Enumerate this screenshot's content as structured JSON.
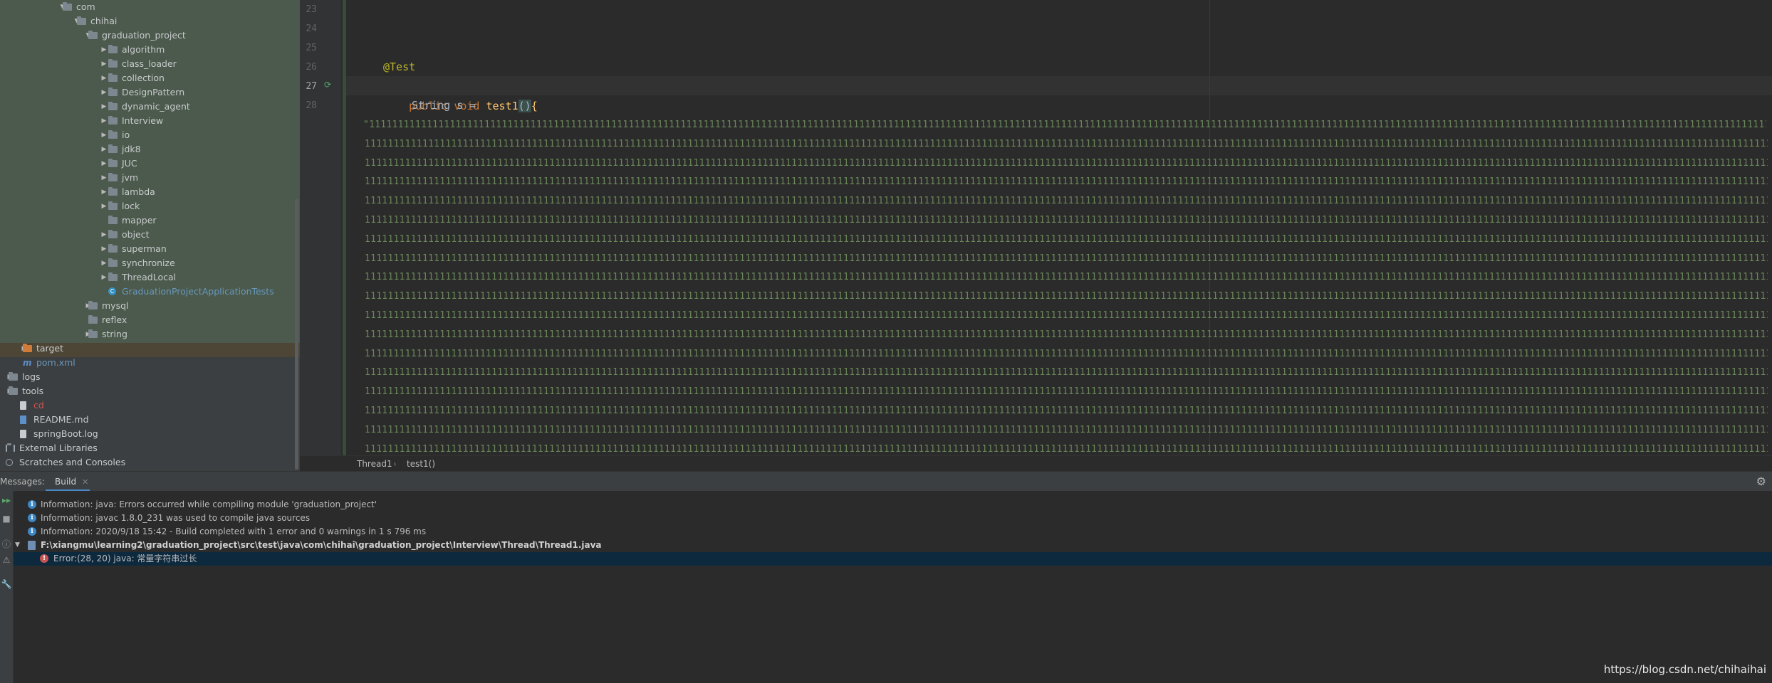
{
  "project_tree": {
    "rows": [
      {
        "label": "com",
        "arrow": "▼",
        "icon": "folder",
        "color": "normal"
      },
      {
        "label": "chihai",
        "arrow": "▼",
        "icon": "folder",
        "color": "normal"
      },
      {
        "label": "graduation_project",
        "arrow": "▼",
        "icon": "folder",
        "color": "normal"
      },
      {
        "label": "algorithm",
        "arrow": "▶",
        "icon": "folder",
        "color": "normal"
      },
      {
        "label": "class_loader",
        "arrow": "▶",
        "icon": "folder",
        "color": "normal"
      },
      {
        "label": "collection",
        "arrow": "▶",
        "icon": "folder",
        "color": "normal"
      },
      {
        "label": "DesignPattern",
        "arrow": "▶",
        "icon": "folder",
        "color": "normal"
      },
      {
        "label": "dynamic_agent",
        "arrow": "▶",
        "icon": "folder",
        "color": "normal"
      },
      {
        "label": "Interview",
        "arrow": "▶",
        "icon": "folder",
        "color": "normal"
      },
      {
        "label": "io",
        "arrow": "▶",
        "icon": "folder",
        "color": "normal"
      },
      {
        "label": "jdk8",
        "arrow": "▶",
        "icon": "folder",
        "color": "normal"
      },
      {
        "label": "JUC",
        "arrow": "▶",
        "icon": "folder",
        "color": "normal"
      },
      {
        "label": "jvm",
        "arrow": "▶",
        "icon": "folder",
        "color": "normal"
      },
      {
        "label": "lambda",
        "arrow": "▶",
        "icon": "folder",
        "color": "normal"
      },
      {
        "label": "lock",
        "arrow": "▶",
        "icon": "folder",
        "color": "normal"
      },
      {
        "label": "mapper",
        "arrow": "",
        "icon": "folder",
        "color": "normal"
      },
      {
        "label": "object",
        "arrow": "▶",
        "icon": "folder",
        "color": "normal"
      },
      {
        "label": "superman",
        "arrow": "▶",
        "icon": "folder",
        "color": "normal"
      },
      {
        "label": "synchronize",
        "arrow": "▶",
        "icon": "folder",
        "color": "normal"
      },
      {
        "label": "ThreadLocal",
        "arrow": "▶",
        "icon": "folder",
        "color": "normal"
      },
      {
        "label": "GraduationProjectApplicationTests",
        "arrow": "",
        "icon": "class",
        "color": "blue"
      },
      {
        "label": "mysql",
        "arrow": "▶",
        "icon": "folder",
        "color": "normal"
      },
      {
        "label": "reflex",
        "arrow": "",
        "icon": "folder",
        "color": "normal"
      },
      {
        "label": "string",
        "arrow": "▶",
        "icon": "folder",
        "color": "normal"
      },
      {
        "label": "target",
        "arrow": "▶",
        "icon": "folder-orange",
        "color": "normal"
      },
      {
        "label": "pom.xml",
        "arrow": "",
        "icon": "maven",
        "color": "blue"
      },
      {
        "label": "logs",
        "arrow": "▶",
        "icon": "folder",
        "color": "normal"
      },
      {
        "label": "tools",
        "arrow": "▶",
        "icon": "folder",
        "color": "normal"
      },
      {
        "label": "cd",
        "arrow": "",
        "icon": "file",
        "color": "red"
      },
      {
        "label": "README.md",
        "arrow": "",
        "icon": "file-md",
        "color": "normal"
      },
      {
        "label": "springBoot.log",
        "arrow": "",
        "icon": "file",
        "color": "normal"
      },
      {
        "label": "External Libraries",
        "arrow": "",
        "icon": "library",
        "color": "normal"
      },
      {
        "label": "Scratches and Consoles",
        "arrow": "",
        "icon": "scratch",
        "color": "normal"
      }
    ]
  },
  "editor": {
    "line_numbers": [
      "23",
      "24",
      "25",
      "26",
      "27",
      "28"
    ],
    "current_line": "27",
    "annotation": "@Test",
    "kw_public": "public",
    "kw_void": "void",
    "method_name": "test1",
    "parens": "()",
    "open_brace": "{",
    "string_decl": "String s =",
    "string_first_line": "\"11111111111111111111111111111111111111111111111111111111111111111111111111111111111111111111111111111111111111111111111111111111111111111111111111111111111111111111111111111111111111111111111111111111111111111111111111111111111111111111111111111111111",
    "string_line": "1111111111111111111111111111111111111111111111111111111111111111111111111111111111111111111111111111111111111111111111111111111111111111111111111111111111111111111111111111111111111111111111111111111111111111111111111111111111111111111111111111111111111"
  },
  "breadcrumb": {
    "class_name": "Thread1",
    "separator": "›",
    "method_name": "test1()"
  },
  "messages": {
    "title": "Messages:",
    "tab_label": "Build",
    "tab_close": "✕",
    "rows": [
      {
        "kind": "info",
        "text": "Information: java: Errors occurred while compiling module 'graduation_project'"
      },
      {
        "kind": "info",
        "text": "Information: javac 1.8.0_231 was used to compile java sources"
      },
      {
        "kind": "info",
        "text": "Information: 2020/9/18 15:42 - Build completed with 1 error and 0 warnings in 1 s 796 ms"
      },
      {
        "kind": "file",
        "text": "F:\\xiangmu\\learning2\\graduation_project\\src\\test\\java\\com\\chihai\\graduation_project\\Interview\\Thread\\Thread1.java"
      },
      {
        "kind": "error",
        "text": "Error:(28, 20)  java: 常量字符串过长"
      }
    ]
  },
  "watermark": "https://blog.csdn.net/chihaihai",
  "colors": {
    "accent": "#4a88c7",
    "string_green": "#6a8759",
    "keyword_orange": "#cc7832",
    "method_yellow": "#ffc66d",
    "error_red": "#c75450"
  }
}
